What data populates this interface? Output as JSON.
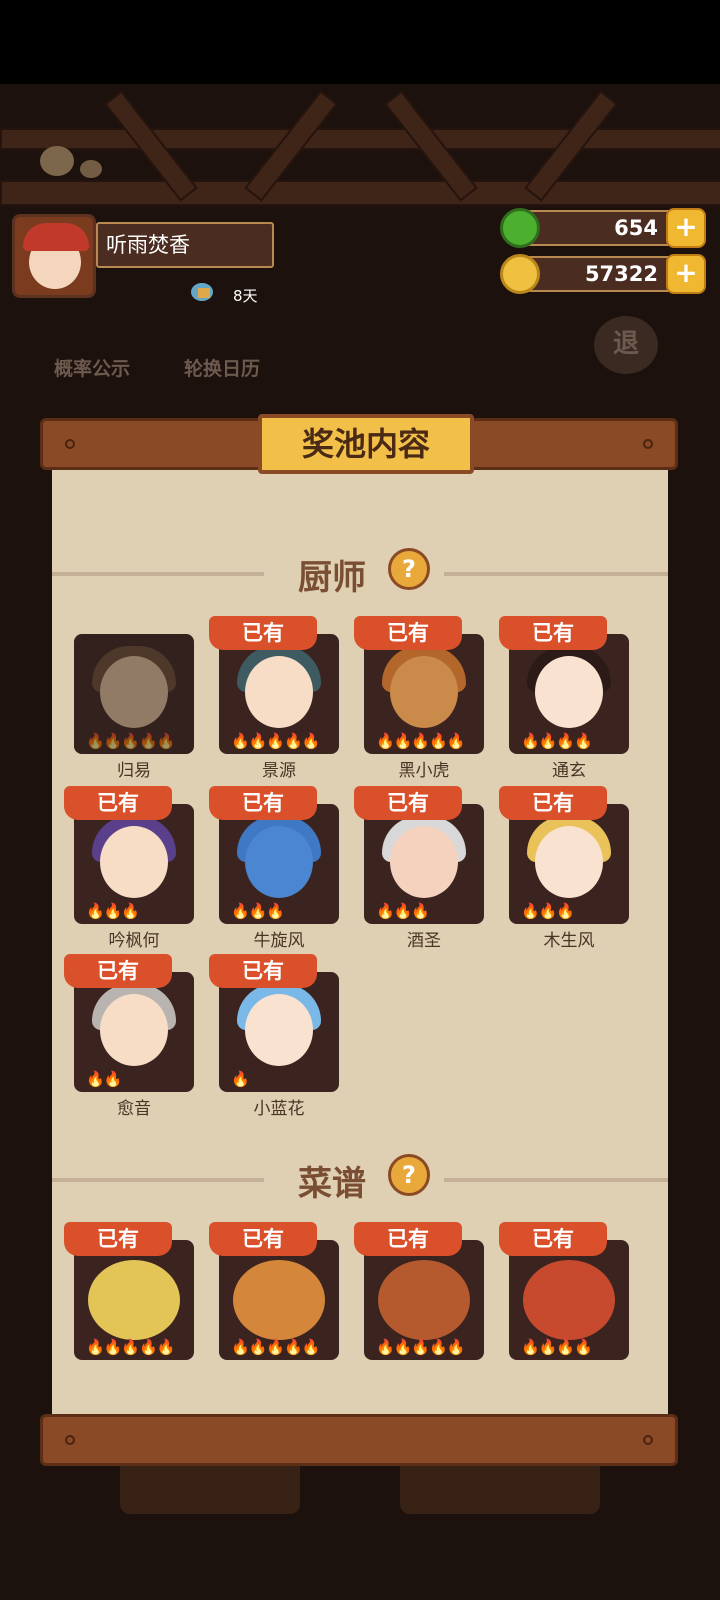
{
  "player": {
    "name": "听雨焚香",
    "days": "8天"
  },
  "currency": {
    "jade": "654",
    "coins": "57322"
  },
  "bg_buttons": {
    "probability": "概率公示",
    "rotation": "轮换日历",
    "exit": "退"
  },
  "panel": {
    "title": "奖池内容",
    "chef_section": "厨师",
    "recipe_section": "菜谱",
    "chefs": [
      {
        "name": "归易",
        "owned": "",
        "stars": "🔥🔥🔥🔥🔥"
      },
      {
        "name": "景源",
        "owned": "已有",
        "stars": "🔥🔥🔥🔥🔥"
      },
      {
        "name": "黑小虎",
        "owned": "已有",
        "stars": "🔥🔥🔥🔥🔥"
      },
      {
        "name": "通玄",
        "owned": "已有",
        "stars": "🔥🔥🔥🔥"
      },
      {
        "name": "吟枫何",
        "owned": "已有",
        "stars": "🔥🔥🔥"
      },
      {
        "name": "牛旋风",
        "owned": "已有",
        "stars": "🔥🔥🔥"
      },
      {
        "name": "酒圣",
        "owned": "已有",
        "stars": "🔥🔥🔥"
      },
      {
        "name": "木生风",
        "owned": "已有",
        "stars": "🔥🔥🔥"
      },
      {
        "name": "愈音",
        "owned": "已有",
        "stars": "🔥🔥"
      },
      {
        "name": "小蓝花",
        "owned": "已有",
        "stars": "🔥"
      }
    ],
    "recipes": [
      {
        "owned": "已有",
        "stars": "🔥🔥🔥🔥🔥"
      },
      {
        "owned": "已有",
        "stars": "🔥🔥🔥🔥🔥"
      },
      {
        "owned": "已有",
        "stars": "🔥🔥🔥🔥🔥"
      },
      {
        "owned": "已有",
        "stars": "🔥🔥🔥🔥"
      }
    ]
  },
  "colors": {
    "owned_badge": "#d9502a",
    "paper": "#dfd0b4",
    "wood": "#8a4a25",
    "plate": "#f2c048"
  }
}
